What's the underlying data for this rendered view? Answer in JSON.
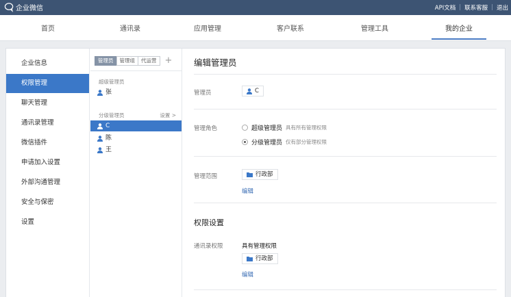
{
  "topbar": {
    "brand": "企业微信",
    "links": [
      "API文档",
      "联系客服",
      "退出"
    ]
  },
  "nav": {
    "items": [
      "首页",
      "通讯录",
      "应用管理",
      "客户联系",
      "管理工具",
      "我的企业"
    ],
    "active_index": 5
  },
  "sidebar": {
    "items": [
      "企业信息",
      "权限管理",
      "聊天管理",
      "通讯录管理",
      "微信插件",
      "申请加入设置",
      "外部沟通管理",
      "安全与保密",
      "设置"
    ],
    "active_index": 1
  },
  "middle": {
    "tabs": [
      "管理员",
      "管理组",
      "代运营"
    ],
    "add_symbol": "+",
    "super_group_label": "超级管理员",
    "super_members": [
      "张"
    ],
    "sub_group_label": "分级管理员",
    "sub_group_action": "设置 >",
    "sub_members": [
      "C",
      "陈",
      "王"
    ],
    "active_sub_member": 0
  },
  "content": {
    "title": "编辑管理员",
    "admin_label": "管理员",
    "admin_value": "C",
    "role_label": "管理角色",
    "role_options": [
      {
        "title": "超级管理员",
        "desc": "具有所有管理权限",
        "selected": false
      },
      {
        "title": "分级管理员",
        "desc": "仅有部分管理权限",
        "selected": true
      }
    ],
    "scope_label": "管理范围",
    "scope_value": "行政部",
    "scope_edit": "编辑",
    "perm_section_title": "权限设置",
    "contacts_perm_label": "通讯录权限",
    "contacts_perm_value": "具有管理权限",
    "contacts_perm_dept": "行政部",
    "contacts_perm_edit": "编辑"
  },
  "colors": {
    "topbar_bg": "#3d5473",
    "accent": "#3b78c8",
    "link": "#3b6eb5"
  }
}
